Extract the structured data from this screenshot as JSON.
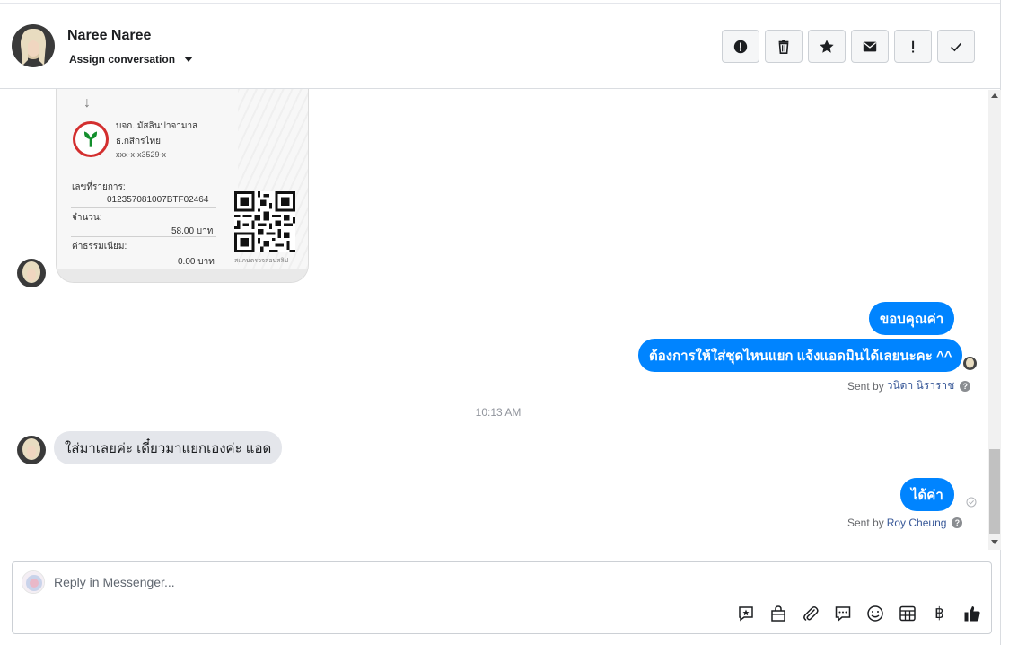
{
  "header": {
    "contact_name": "Naree Naree",
    "assign_label": "Assign conversation"
  },
  "actions": [
    {
      "name": "alert-icon"
    },
    {
      "name": "trash-icon"
    },
    {
      "name": "star-icon"
    },
    {
      "name": "envelope-icon"
    },
    {
      "name": "exclamation-icon"
    },
    {
      "name": "checkmark-icon"
    }
  ],
  "receipt": {
    "payee_name": "บจก. มัสลินปาจามาส",
    "bank": "ธ.กสิกรไทย",
    "account": "xxx-x-x3529-x",
    "ref_label": "เลขที่รายการ:",
    "ref_value": "012357081007BTF02464",
    "amount_label": "จำนวน:",
    "amount_value": "58.00 บาท",
    "fee_label": "ค่าธรรมเนียม:",
    "fee_value": "0.00 บาท",
    "qr_caption": "สแกนตรวจสอบสลิป"
  },
  "messages": {
    "out1": "ขอบคุณค่า",
    "out2": "ต้องการให้ใส่ชุดไหนแยก แจ้งแอดมินได้เลยนะคะ ^^",
    "out1_sent_prefix": "Sent by",
    "out1_sent_by": "วนิดา นิราราช",
    "timestamp": "10:13 AM",
    "in1": "ใส่มาเลยค่ะ เดี๋ยวมาแยกเองค่ะ แอด",
    "out3": "ได้ค่า",
    "out3_sent_prefix": "Sent by",
    "out3_sent_by": "Roy Cheung",
    "help": "?"
  },
  "composer": {
    "placeholder": "Reply in Messenger..."
  },
  "tools": [
    {
      "name": "saved-reply-icon"
    },
    {
      "name": "shopping-bag-icon"
    },
    {
      "name": "paperclip-icon"
    },
    {
      "name": "chat-bubble-icon"
    },
    {
      "name": "emoji-icon"
    },
    {
      "name": "table-icon"
    },
    {
      "name": "baht-icon",
      "glyph": "฿"
    },
    {
      "name": "thumbs-up-icon"
    }
  ],
  "colors": {
    "outgoing_bubble": "#0084ff",
    "incoming_bubble": "#e4e6eb",
    "kbank_red": "#d32f2f",
    "kbank_green": "#138f2d"
  }
}
